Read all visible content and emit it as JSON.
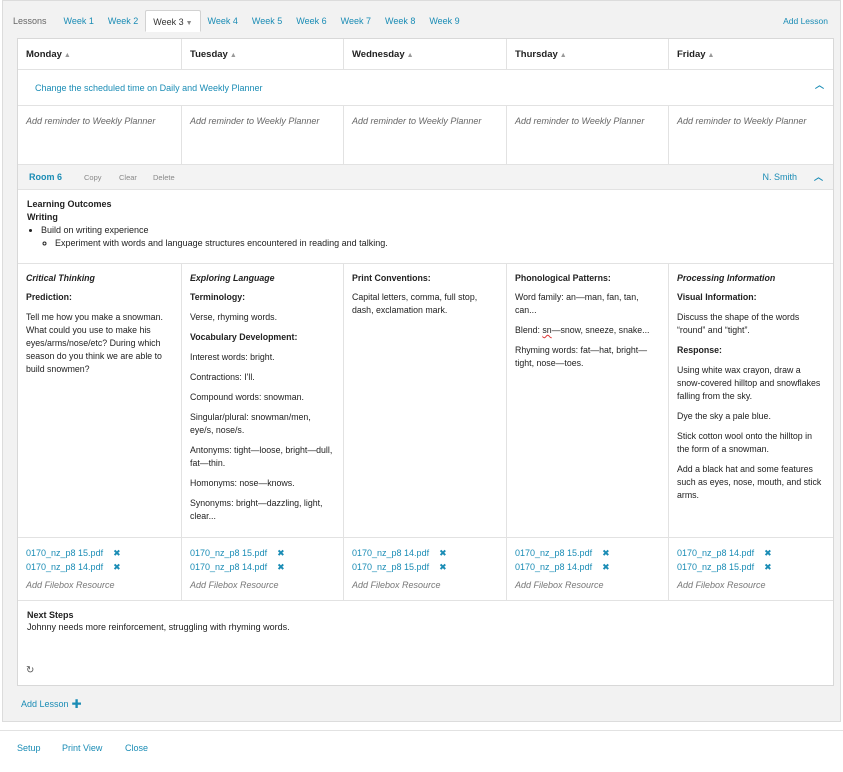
{
  "tabs": {
    "label": "Lessons",
    "items": [
      "Week 1",
      "Week 2",
      "Week 3",
      "Week 4",
      "Week 5",
      "Week 6",
      "Week 7",
      "Week 8",
      "Week 9"
    ],
    "active": "Week 3",
    "add_lesson": "Add Lesson"
  },
  "days": [
    "Monday",
    "Tuesday",
    "Wednesday",
    "Thursday",
    "Friday"
  ],
  "schedule_link": "Change the scheduled time on Daily and Weekly Planner",
  "reminder_placeholder": "Add reminder to Weekly Planner",
  "room": {
    "name": "Room 6",
    "actions": {
      "copy": "Copy",
      "clear": "Clear",
      "delete": "Delete"
    },
    "teacher": "N. Smith"
  },
  "outcomes": {
    "title": "Learning Outcomes",
    "subject": "Writing",
    "item": "Build on writing experience",
    "subitem": "Experiment with words and language structures encountered in reading and talking."
  },
  "columns": {
    "monday": {
      "title": "Critical Thinking",
      "p1": "Prediction:",
      "p2": "Tell me how you make a snowman. What could you use to make his eyes/arms/nose/etc? During which season do you think we are able to build snowmen?"
    },
    "tuesday": {
      "title": "Exploring Language",
      "p1": "Terminology:",
      "p2": "Verse, rhyming words.",
      "p3": "Vocabulary Development:",
      "p4": "Interest words: bright.",
      "p5": "Contractions: I'll.",
      "p6": "Compound words: snowman.",
      "p7": "Singular/plural: snowman/men, eye/s, nose/s.",
      "p8": "Antonyms: tight—loose, bright—dull, fat—thin.",
      "p9": "Homonyms: nose—knows.",
      "p10": "Synonyms: bright—dazzling, light, clear..."
    },
    "wednesday": {
      "title": "Print Conventions:",
      "p1": "Capital letters, comma, full stop, dash, exclamation mark."
    },
    "thursday": {
      "title": "Phonological Patterns:",
      "p1": "Word family: an—man, fan, tan, can...",
      "p2a": "Blend: ",
      "p2b": "sn",
      "p2c": "—snow, sneeze, snake...",
      "p3": "Rhyming words: fat—hat, bright—tight, nose—toes."
    },
    "friday": {
      "title": "Processing Information",
      "p1": "Visual Information:",
      "p2": "Discuss the shape of the words “round” and “tight”.",
      "p3": "Response:",
      "p4": "Using white wax crayon, draw a snow-covered hilltop and snowflakes falling from the sky.",
      "p5": "Dye the sky a pale blue.",
      "p6": "Stick cotton wool onto the hilltop in the form of a snowman.",
      "p7": "Add a black hat and some features such as eyes, nose, mouth, and stick arms."
    }
  },
  "files": {
    "monday": [
      "0170_nz_p8 15.pdf",
      "0170_nz_p8 14.pdf"
    ],
    "tuesday": [
      "0170_nz_p8 15.pdf",
      "0170_nz_p8 14.pdf"
    ],
    "wednesday": [
      "0170_nz_p8 14.pdf",
      "0170_nz_p8 15.pdf"
    ],
    "thursday": [
      "0170_nz_p8 15.pdf",
      "0170_nz_p8 14.pdf"
    ],
    "friday": [
      "0170_nz_p8 14.pdf",
      "0170_nz_p8 15.pdf"
    ]
  },
  "add_file_label": "Add Filebox Resource",
  "next_steps": {
    "title": "Next Steps",
    "text": "Johnny needs more reinforcement, struggling with rhyming words."
  },
  "add_lesson_bottom": "Add Lesson",
  "footer": {
    "setup": "Setup",
    "print_view": "Print View",
    "close": "Close"
  },
  "icons": {
    "sort": "chevron-up-icon",
    "collapse": "chevron-up-icon",
    "remove": "close-icon",
    "refresh": "refresh-icon",
    "add": "plus-icon"
  },
  "colors": {
    "accent": "#1a8cb5",
    "bar": "#f3f3f3"
  }
}
